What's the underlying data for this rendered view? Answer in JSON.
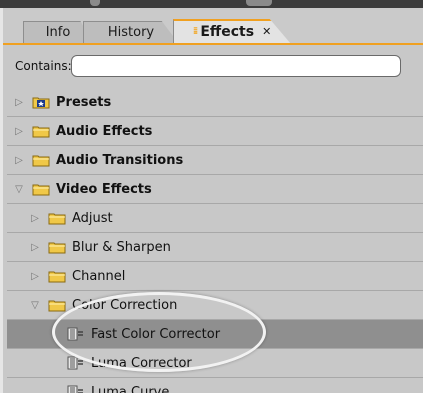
{
  "tabs": [
    {
      "label": "Info"
    },
    {
      "label": "History"
    },
    {
      "label": "Effects",
      "close": "✕"
    }
  ],
  "search": {
    "label": "Contains:",
    "value": "",
    "placeholder": ""
  },
  "tree": [
    {
      "label": "Presets",
      "level": 0,
      "expanded": false,
      "icon": "presets-folder-icon",
      "bold": true
    },
    {
      "label": "Audio Effects",
      "level": 0,
      "expanded": false,
      "icon": "folder-icon",
      "bold": true
    },
    {
      "label": "Audio Transitions",
      "level": 0,
      "expanded": false,
      "icon": "folder-icon",
      "bold": true
    },
    {
      "label": "Video Effects",
      "level": 0,
      "expanded": true,
      "icon": "folder-icon",
      "bold": true
    },
    {
      "label": "Adjust",
      "level": 1,
      "expanded": false,
      "icon": "folder-icon",
      "bold": false
    },
    {
      "label": "Blur & Sharpen",
      "level": 1,
      "expanded": false,
      "icon": "folder-icon",
      "bold": false
    },
    {
      "label": "Channel",
      "level": 1,
      "expanded": false,
      "icon": "folder-icon",
      "bold": false
    },
    {
      "label": "Color Correction",
      "level": 1,
      "expanded": true,
      "icon": "folder-icon",
      "bold": false
    },
    {
      "label": "Fast Color Corrector",
      "level": 2,
      "icon": "effect-icon",
      "selected": true
    },
    {
      "label": "Luma Corrector",
      "level": 2,
      "icon": "effect-icon"
    },
    {
      "label": "Luma Curve",
      "level": 2,
      "icon": "effect-icon"
    }
  ],
  "colors": {
    "accent": "#f0a020",
    "folder": "#f0c848",
    "selected": "#8f8f8f",
    "panel": "#c8c8c8"
  }
}
